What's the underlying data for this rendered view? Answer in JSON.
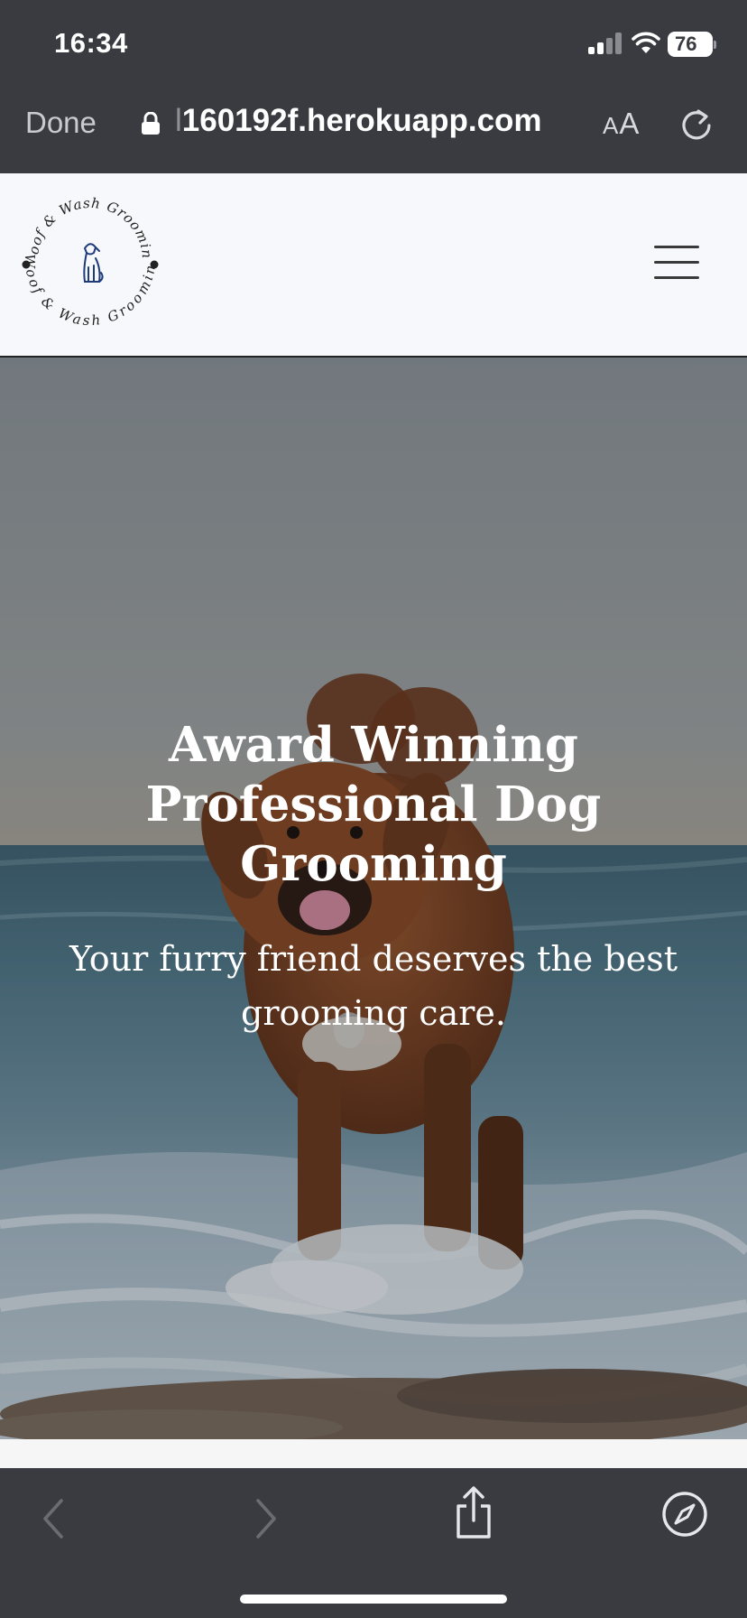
{
  "status_bar": {
    "time": "16:34",
    "battery": "76",
    "signal_icon": "cellular-signal-icon",
    "wifi_icon": "wifi-icon"
  },
  "browser": {
    "done_label": "Done",
    "url_hidden_fragment": "l",
    "url": "160192f.herokuapp.com",
    "text_size_label_small": "A",
    "text_size_label_large": "A",
    "icons": {
      "lock": "lock-icon",
      "reload": "reload-icon",
      "back": "back-chevron-icon",
      "forward": "forward-chevron-icon",
      "share": "share-icon",
      "open_in_safari": "compass-icon"
    }
  },
  "site": {
    "logo_text": "Woof & Wash Grooming",
    "menu_icon": "hamburger-menu-icon"
  },
  "hero": {
    "title": "Award Winning Professional Dog Grooming",
    "subtitle": "Your furry friend deserves the best grooming care."
  },
  "colors": {
    "browser_chrome": "#3a3b40",
    "header_bg": "#f7f8fb",
    "logo_ink": "#1f3b7a"
  }
}
